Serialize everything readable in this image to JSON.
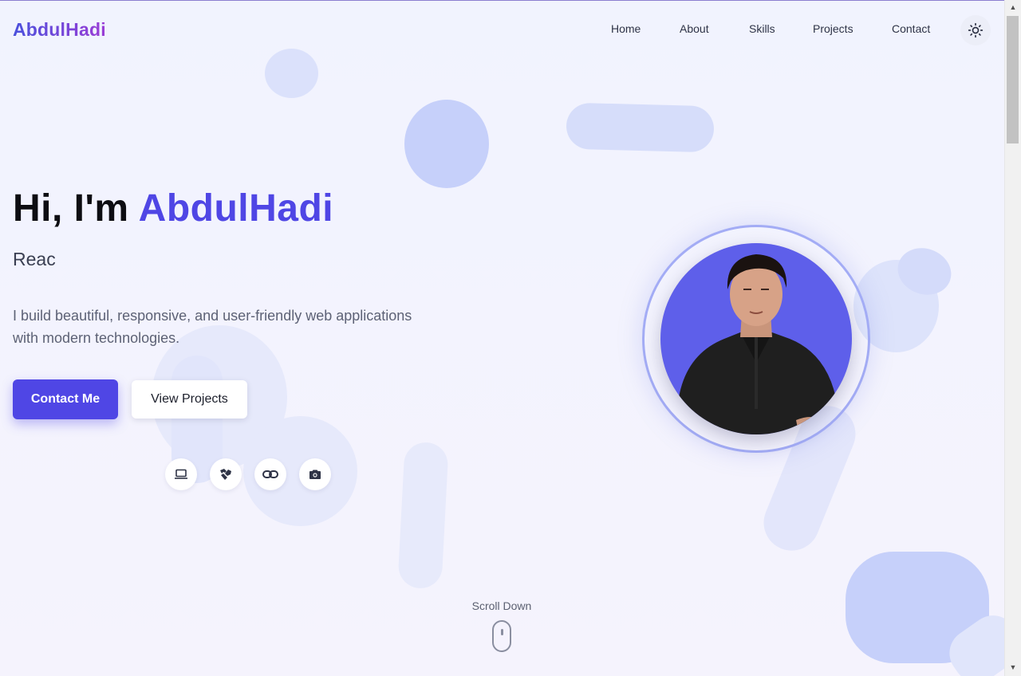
{
  "brand": {
    "logo": "AbdulHadi"
  },
  "nav": {
    "items": [
      {
        "label": "Home",
        "name": "nav-home"
      },
      {
        "label": "About",
        "name": "nav-about"
      },
      {
        "label": "Skills",
        "name": "nav-skills"
      },
      {
        "label": "Projects",
        "name": "nav-projects"
      },
      {
        "label": "Contact",
        "name": "nav-contact"
      }
    ],
    "theme_icon": "sun-icon"
  },
  "hero": {
    "greeting": "Hi, I'm ",
    "name": "AbdulHadi",
    "typed_role": "Reac",
    "description": "I build beautiful, responsive, and user-friendly web applications with modern technologies.",
    "primary_button": "Contact Me",
    "secondary_button": "View Projects",
    "social_icons": [
      "laptop-icon",
      "handshake-icon",
      "link-icon",
      "camera-icon"
    ]
  },
  "scroll": {
    "label": "Scroll Down"
  },
  "colors": {
    "accent": "#4f46e5",
    "logo_gradient_start": "#4a50dc",
    "logo_gradient_end": "#9b3dd6",
    "avatar_bg": "#5e5fea"
  }
}
